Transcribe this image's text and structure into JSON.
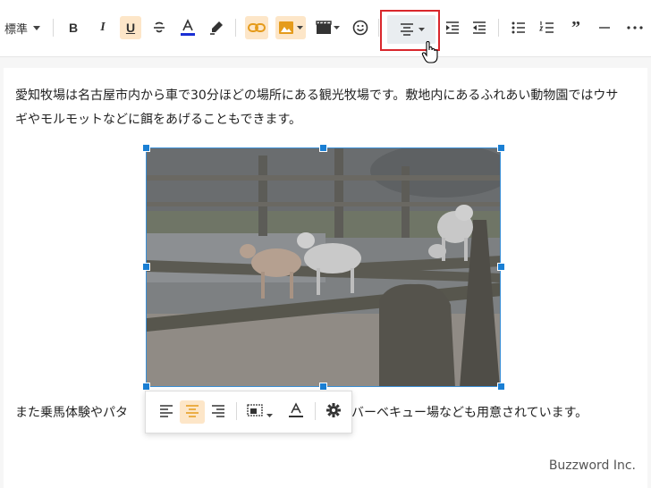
{
  "toolbar": {
    "format_select": "標準",
    "buttons": [
      "bold",
      "italic",
      "underline",
      "strikethrough",
      "font-color",
      "highlight",
      "link",
      "image",
      "media",
      "emoji",
      "align",
      "indent",
      "outdent",
      "bulleted-list",
      "numbered-list",
      "blockquote",
      "horizontal-line",
      "more"
    ],
    "highlight_color": "#fde6c8",
    "font_color_bar": "#1a2fd4",
    "marker_color": "#e59b1b"
  },
  "content": {
    "paragraph1": "愛知牧場は名古屋市内から車で30分ほどの場所にある観光牧場です。敷地内にあるふれあい動物園ではウサギやモルモットなどに餌をあげることもできます。",
    "paragraph2_before": "また乗馬体験やパタ",
    "paragraph2_after": "体験やバーベキュー場なども用意されています。"
  },
  "image": {
    "subject": "goats-on-wooden-ramp-photo"
  },
  "image_toolbar": {
    "buttons": [
      "align-left",
      "align-center",
      "align-right",
      "image-style",
      "alt-text",
      "settings"
    ]
  },
  "watermark": "Buzzword Inc."
}
